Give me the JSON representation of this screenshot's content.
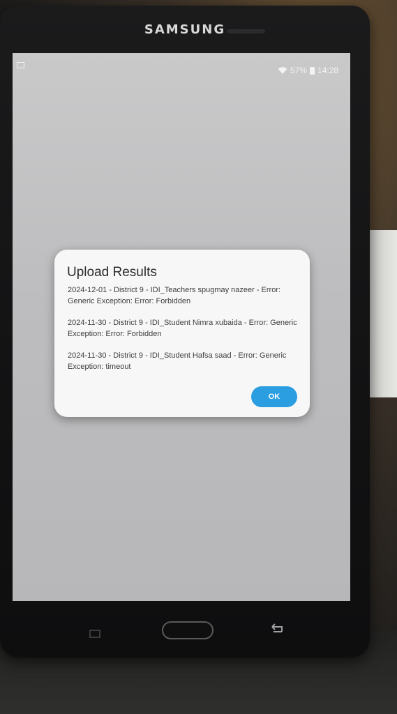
{
  "device": {
    "brand": "SAMSUNG"
  },
  "statusbar": {
    "battery": "57%",
    "time": "14:28",
    "icons": [
      "notification-icon",
      "wifi-icon",
      "battery-icon"
    ]
  },
  "dialog": {
    "title": "Upload Results",
    "results": [
      "2024-12-01 - District 9 - IDI_Teachers spugmay nazeer - Error: Generic Exception: Error: Forbidden",
      "2024-11-30 - District 9 - IDI_Student Nimra xubaida - Error: Generic Exception: Error: Forbidden",
      "2024-11-30 - District 9 - IDI_Student Hafsa saad - Error: Generic Exception: timeout"
    ],
    "ok_label": "OK"
  },
  "colors": {
    "accent": "#2a9ee0",
    "dialog_bg": "#f7f7f7",
    "screen_bg": "#c0c0c2"
  }
}
